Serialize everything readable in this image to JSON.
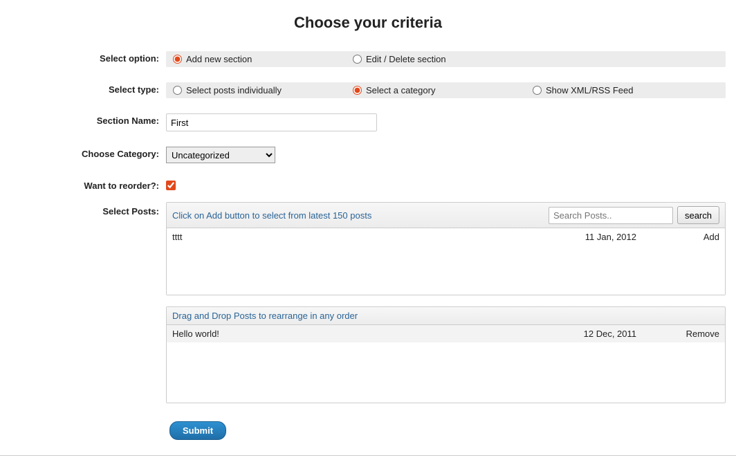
{
  "title": "Choose your criteria",
  "labels": {
    "select_option": "Select option:",
    "select_type": "Select type:",
    "section_name": "Section Name:",
    "choose_category": "Choose Category:",
    "want_reorder": "Want to reorder?:",
    "select_posts": "Select Posts:"
  },
  "options": {
    "add_new": "Add new section",
    "edit_delete": "Edit / Delete section"
  },
  "types": {
    "individually": "Select posts individually",
    "category": "Select a category",
    "rss": "Show XML/RSS Feed"
  },
  "section_name_value": "First",
  "category": {
    "selected": "Uncategorized",
    "options": [
      "Uncategorized"
    ]
  },
  "reorder_checked": true,
  "available_panel": {
    "hint": "Click on Add button to select from latest 150 posts",
    "search_placeholder": "Search Posts..",
    "search_button": "search",
    "rows": [
      {
        "title": "tttt",
        "date": "11 Jan, 2012",
        "action": "Add"
      }
    ]
  },
  "selected_panel": {
    "hint": "Drag and Drop Posts to rearrange in any order",
    "rows": [
      {
        "title": "Hello world!",
        "date": "12 Dec, 2011",
        "action": "Remove"
      }
    ]
  },
  "submit_label": "Submit"
}
